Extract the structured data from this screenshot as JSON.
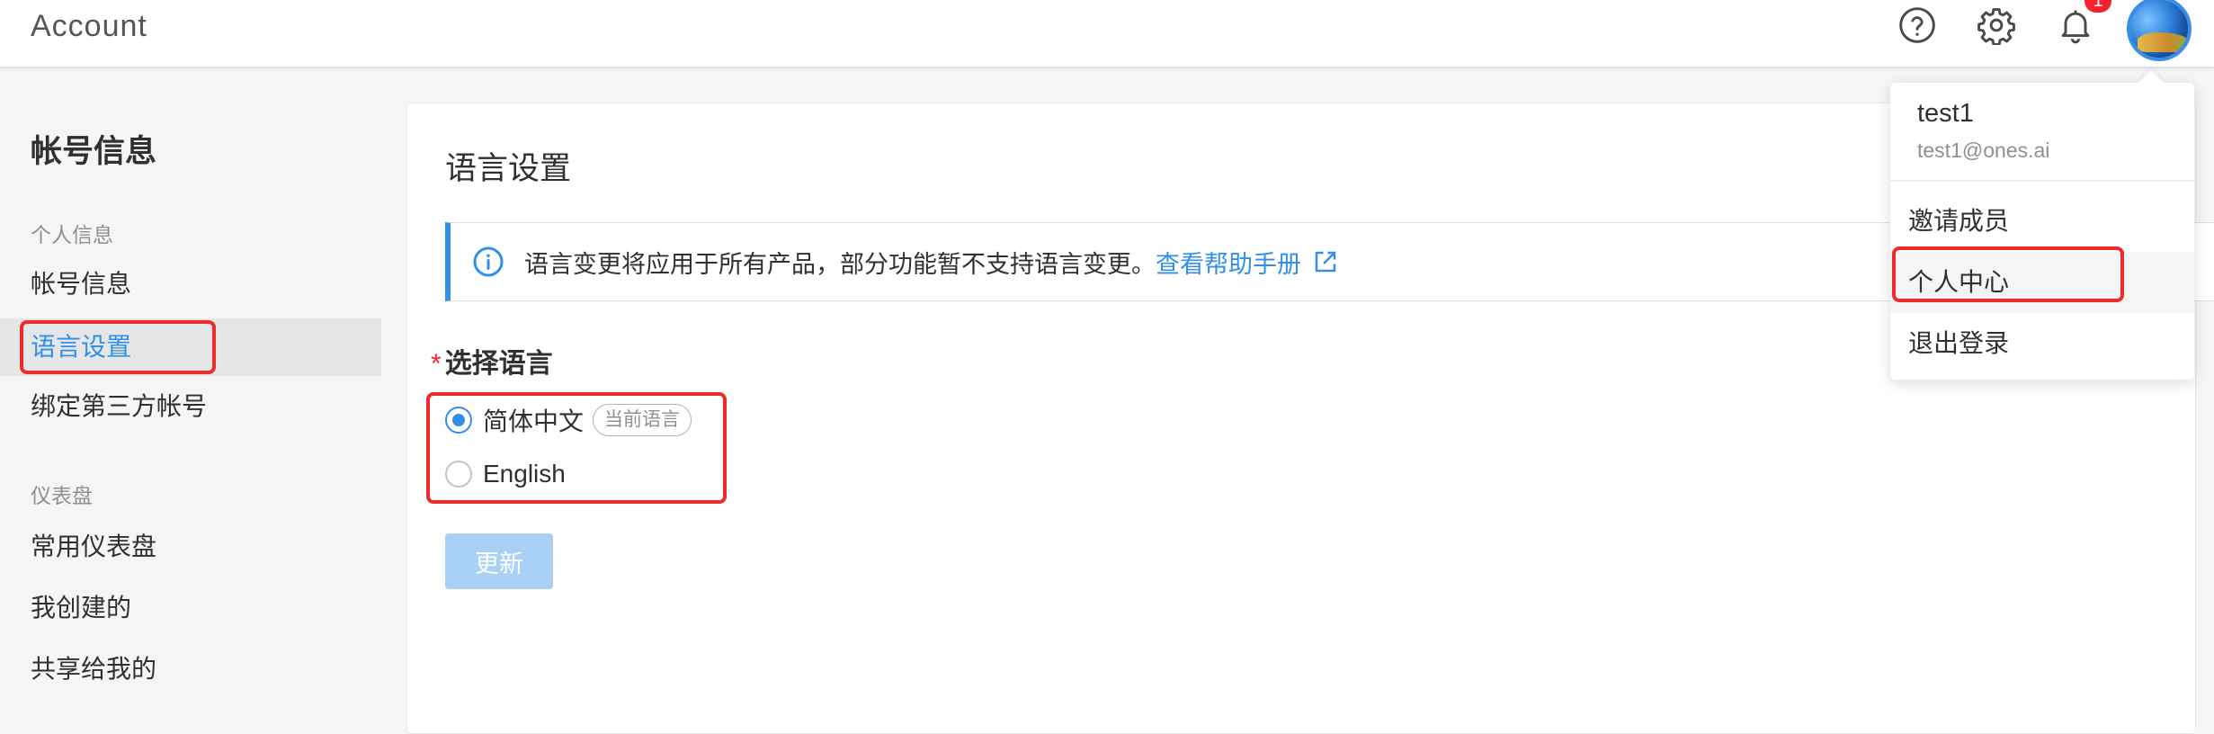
{
  "header": {
    "app_title": "Account",
    "help_icon": "help-circle-icon",
    "settings_icon": "gear-icon",
    "notification_icon": "bell-icon",
    "notification_count": "1",
    "avatar": "user-avatar"
  },
  "sidebar": {
    "title": "帐号信息",
    "groups": [
      {
        "label": "个人信息",
        "items": [
          {
            "label": "帐号信息"
          },
          {
            "label": "语言设置",
            "active": true
          },
          {
            "label": "绑定第三方帐号"
          }
        ]
      },
      {
        "label": "仪表盘",
        "items": [
          {
            "label": "常用仪表盘"
          },
          {
            "label": "我创建的"
          },
          {
            "label": "共享给我的"
          }
        ]
      }
    ]
  },
  "main": {
    "title": "语言设置",
    "info": {
      "icon": "info-circle-icon",
      "text": "语言变更将应用于所有产品，部分功能暂不支持语言变更。",
      "link_text": "查看帮助手册",
      "link_icon": "external-link-icon"
    },
    "field": {
      "required_mark": "*",
      "label": "选择语言",
      "options": [
        {
          "label": "简体中文",
          "tag": "当前语言",
          "selected": true
        },
        {
          "label": "English",
          "selected": false
        }
      ]
    },
    "update_button": "更新"
  },
  "user_menu": {
    "name": "test1",
    "email": "test1@ones.ai",
    "items": [
      {
        "label": "邀请成员"
      },
      {
        "label": "个人中心"
      },
      {
        "label": "退出登录"
      }
    ]
  },
  "colors": {
    "accent": "#338fe5",
    "highlight": "#ee2b2b",
    "badge": "#f5222d",
    "disabled_button": "#a9d0f5"
  }
}
